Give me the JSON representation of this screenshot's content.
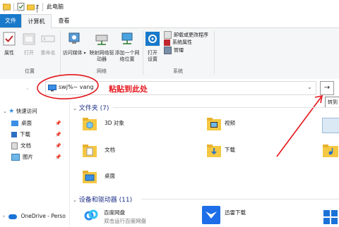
{
  "window": {
    "title": "此电脑"
  },
  "ribbon": {
    "tabs": [
      {
        "label": "文件"
      },
      {
        "label": "计算机"
      },
      {
        "label": "查看"
      }
    ],
    "location_group": {
      "label": "位置",
      "buttons": [
        {
          "label": "属性"
        },
        {
          "label": "打开"
        },
        {
          "label": "重命名"
        }
      ]
    },
    "network_group": {
      "label": "网络",
      "buttons": [
        {
          "label": "访问媒体"
        },
        {
          "label": "映射网络驱动器"
        },
        {
          "label": "添加一个网络位置"
        }
      ]
    },
    "system_group": {
      "label": "系统",
      "open_settings": "打开设置",
      "items": [
        {
          "label": "卸载或更改程序"
        },
        {
          "label": "系统属性"
        },
        {
          "label": "管理"
        }
      ]
    }
  },
  "address_bar": {
    "value": "swj%~ vang",
    "annotation": "粘贴到此处",
    "go_tooltip": "转到"
  },
  "nav_pane": {
    "quick_access": "快速访问",
    "items": [
      {
        "label": "桌面"
      },
      {
        "label": "下载"
      },
      {
        "label": "文档"
      },
      {
        "label": "图片"
      }
    ],
    "onedrive": "OneDrive - Perso"
  },
  "content": {
    "folders_header": "文件夹 (7)",
    "folders": [
      {
        "label": "3D 对象"
      },
      {
        "label": "视频"
      },
      {
        "label": "文档"
      },
      {
        "label": "下载"
      },
      {
        "label": "桌面"
      }
    ],
    "devices_header": "设备和驱动器 (11)",
    "devices": [
      {
        "label": "百度网盘",
        "sublabel": "双击运行百度网盘"
      },
      {
        "label": "迅雷下载"
      }
    ]
  },
  "colors": {
    "accent": "#1979ca",
    "annotation": "#e4161c",
    "folder": "#f5c842"
  }
}
